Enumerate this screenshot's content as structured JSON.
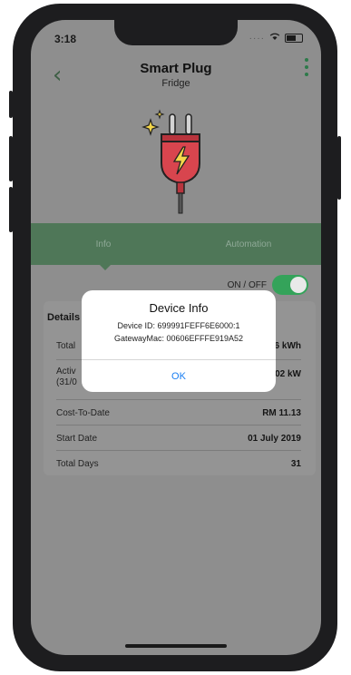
{
  "status_bar": {
    "time": "3:18"
  },
  "header": {
    "title": "Smart Plug",
    "subtitle": "Fridge",
    "back_glyph": "‹"
  },
  "tabs": [
    {
      "label": "Info"
    },
    {
      "label": "Automation"
    }
  ],
  "toggle": {
    "label": "ON / OFF",
    "state": "on"
  },
  "details": {
    "title": "Details",
    "rows": [
      {
        "label": "Total",
        "value": "6 kWh"
      },
      {
        "label": "Activ",
        "label2": "(31/0",
        "value": "02 kW"
      },
      {
        "label": "Cost-To-Date",
        "value": "RM 11.13"
      },
      {
        "label": "Start Date",
        "value": "01 July 2019"
      },
      {
        "label": "Total Days",
        "value": "31"
      }
    ]
  },
  "dialog": {
    "title": "Device Info",
    "line1": "Device ID: 699991FEFF6E6000:1",
    "line2": "GatewayMac: 00606EFFFE919A52",
    "ok_label": "OK"
  },
  "colors": {
    "accent_green": "#34a35a",
    "tab_green": "#4f7758",
    "link_blue": "#1a7ef2",
    "plug_red": "#d8454e"
  },
  "icons": [
    "back-chevron-icon",
    "more-vertical-icon",
    "wifi-icon",
    "battery-icon",
    "plug-icon",
    "sparkle-icon",
    "lightning-icon"
  ]
}
